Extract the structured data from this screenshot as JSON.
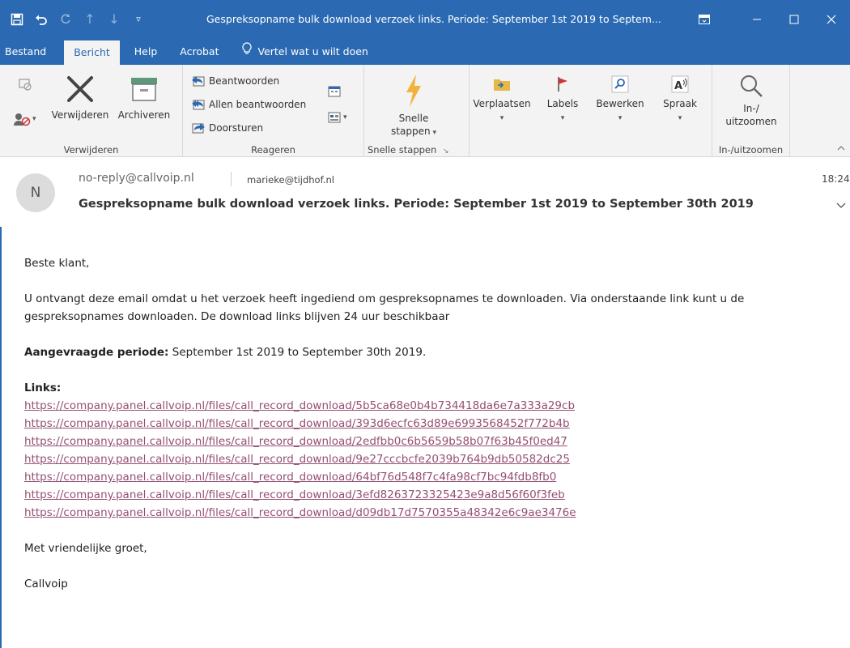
{
  "window": {
    "title": "Gespreksopname bulk download verzoek links. Periode: September 1st 2019 to Septem..."
  },
  "menu": {
    "tabs": [
      "Bestand",
      "Bericht",
      "Help",
      "Acrobat"
    ],
    "tellme": "Vertel wat u wilt doen"
  },
  "ribbon": {
    "verwijderen": {
      "delete": "Verwijderen",
      "archive": "Archiveren",
      "group": "Verwijderen"
    },
    "reageren": {
      "reply": "Beantwoorden",
      "reply_all": "Allen beantwoorden",
      "forward": "Doorsturen",
      "group": "Reageren"
    },
    "quick": {
      "line1": "Snelle",
      "line2": "stappen",
      "group": "Snelle stappen"
    },
    "move": "Verplaatsen",
    "labels": "Labels",
    "edit": "Bewerken",
    "speech": "Spraak",
    "zoom": {
      "line1": "In-/",
      "line2": "uitzoomen",
      "group": "In-/uitzoomen"
    }
  },
  "header": {
    "avatar": "N",
    "from": "no-reply@callvoip.nl",
    "to": "marieke@tijdhof.nl",
    "time": "18:24",
    "subject": "Gespreksopname bulk download verzoek links. Periode: September 1st 2019 to September 30th 2019"
  },
  "body": {
    "greeting": "Beste klant,",
    "intro": "U ontvangt deze email omdat u het verzoek heeft ingediend om gespreksopnames te downloaden. Via onderstaande link kunt u de gespreksopnames downloaden. De download links blijven 24 uur beschikbaar",
    "period_label": "Aangevraagde periode:",
    "period_value": " September 1st 2019 to September 30th 2019.",
    "links_label": "Links:",
    "links": [
      "https://company.panel.callvoip.nl/files/call_record_download/5b5ca68e0b4b734418da6e7a333a29cb",
      "https://company.panel.callvoip.nl/files/call_record_download/393d6ecfc63d89e6993568452f772b4b",
      "https://company.panel.callvoip.nl/files/call_record_download/2edfbb0c6b5659b58b07f63b45f0ed47",
      "https://company.panel.callvoip.nl/files/call_record_download/9e27cccbcfe2039b764b9db50582dc25",
      "https://company.panel.callvoip.nl/files/call_record_download/64bf76d548f7c4fa98cf7bc94fdb8fb0",
      "https://company.panel.callvoip.nl/files/call_record_download/3efd8263723325423e9a8d56f60f3feb",
      "https://company.panel.callvoip.nl/files/call_record_download/d09db17d7570355a48342e6c9ae3476e"
    ],
    "closing": "Met vriendelijke groet,",
    "signature": "Callvoip"
  },
  "colors": {
    "accent": "#2b6ab3",
    "link": "#954f72"
  }
}
